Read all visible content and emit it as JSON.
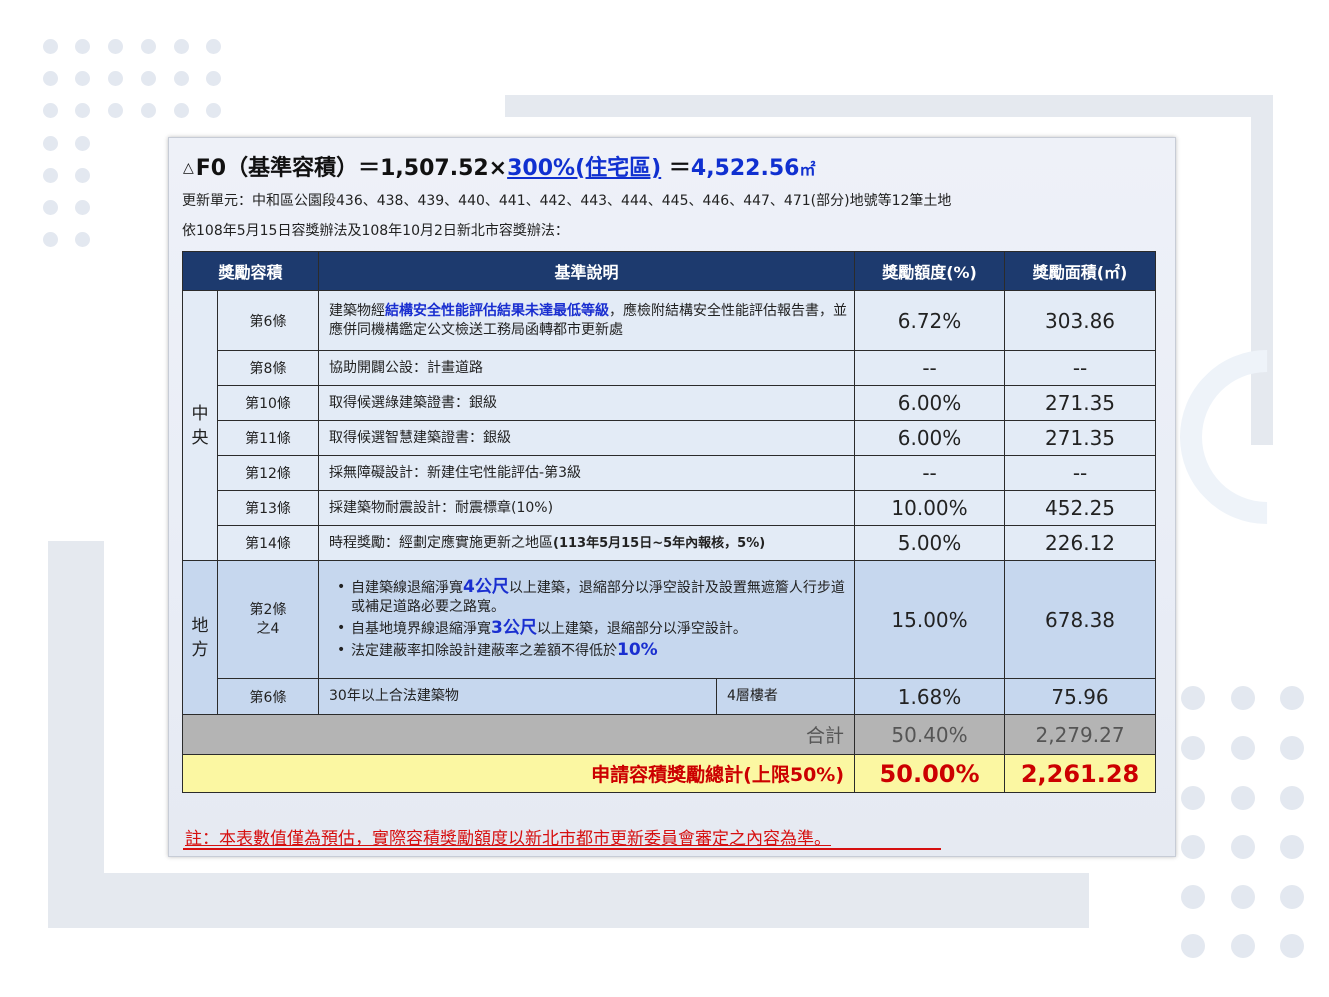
{
  "header": {
    "triangle": "△",
    "title_prefix": "F0（基準容積）＝1,507.52×",
    "rate": "300%(住宅區)",
    "equals": "＝",
    "result": "4,522.56",
    "unit": "㎡"
  },
  "subtitles": {
    "line1": "更新單元：中和區公園段436、438、439、440、441、442、443、444、445、446、447、471(部分)地號等12筆土地",
    "line2": "依108年5月15日容獎辦法及108年10月2日新北市容獎辦法："
  },
  "table": {
    "headers": [
      "獎勵容積",
      "基準說明",
      "獎勵額度(%)",
      "獎勵面積(㎡)"
    ],
    "central": {
      "group_label_1": "中",
      "group_label_2": "央",
      "rows": [
        {
          "article": "第6條",
          "desc_pre": "建築物經",
          "desc_bold": "結構安全性能評估結果未達最低等級",
          "desc_post": "，應檢附結構安全性能評估報告書，並應併同機構鑑定公文檢送工務局函轉都市更新處",
          "pct": "6.72%",
          "area": "303.86"
        },
        {
          "article": "第8條",
          "desc": "協助開闢公設：計畫道路",
          "pct": "--",
          "area": "--"
        },
        {
          "article": "第10條",
          "desc": "取得候選綠建築證書：銀級",
          "pct": "6.00%",
          "area": "271.35"
        },
        {
          "article": "第11條",
          "desc": "取得候選智慧建築證書：銀級",
          "pct": "6.00%",
          "area": "271.35"
        },
        {
          "article": "第12條",
          "desc": "採無障礙設計：新建住宅性能評估-第3級",
          "pct": "--",
          "area": "--"
        },
        {
          "article": "第13條",
          "desc": "採建築物耐震設計：耐震標章(10%)",
          "pct": "10.00%",
          "area": "452.25"
        },
        {
          "article": "第14條",
          "desc_pre": "時程獎勵：經劃定應實施更新之地區",
          "desc_bold": "(113年5月15日~5年內報核，5%)",
          "pct": "5.00%",
          "area": "226.12"
        }
      ]
    },
    "local": {
      "group_label_1": "地",
      "group_label_2": "方",
      "row1": {
        "article_1": "第2條",
        "article_2": "之4",
        "bullet1_pre": "自建築線退縮淨寬",
        "bullet1_bold": "4公尺",
        "bullet1_post": "以上建築，退縮部分以淨空設計及設置無遮簷人行步道或補足道路必要之路寬。",
        "bullet2_pre": "自基地境界線退縮淨寬",
        "bullet2_bold": "3公尺",
        "bullet2_post": "以上建築，退縮部分以淨空設計。",
        "bullet3_pre": "法定建蔽率扣除設計建蔽率之差額不得低於",
        "bullet3_bold": "10%",
        "pct": "15.00%",
        "area": "678.38"
      },
      "row2": {
        "article": "第6條",
        "desc": "30年以上合法建築物",
        "sub": "4層樓者",
        "pct": "1.68%",
        "area": "75.96"
      }
    },
    "sum": {
      "label": "合計",
      "pct": "50.40%",
      "area": "2,279.27"
    },
    "total": {
      "label": "申請容積獎勵總計(上限50%)",
      "pct": "50.00%",
      "area": "2,261.28"
    }
  },
  "note": "註：本表數值僅為預估，實際容積獎勵額度以新北市都市更新委員會審定之內容為準。",
  "colors": {
    "header_bg": "#1d3a6e",
    "accent_blue": "#1a2fd0",
    "total_bg": "#fbf7a2",
    "alert_red": "#cc0000"
  }
}
